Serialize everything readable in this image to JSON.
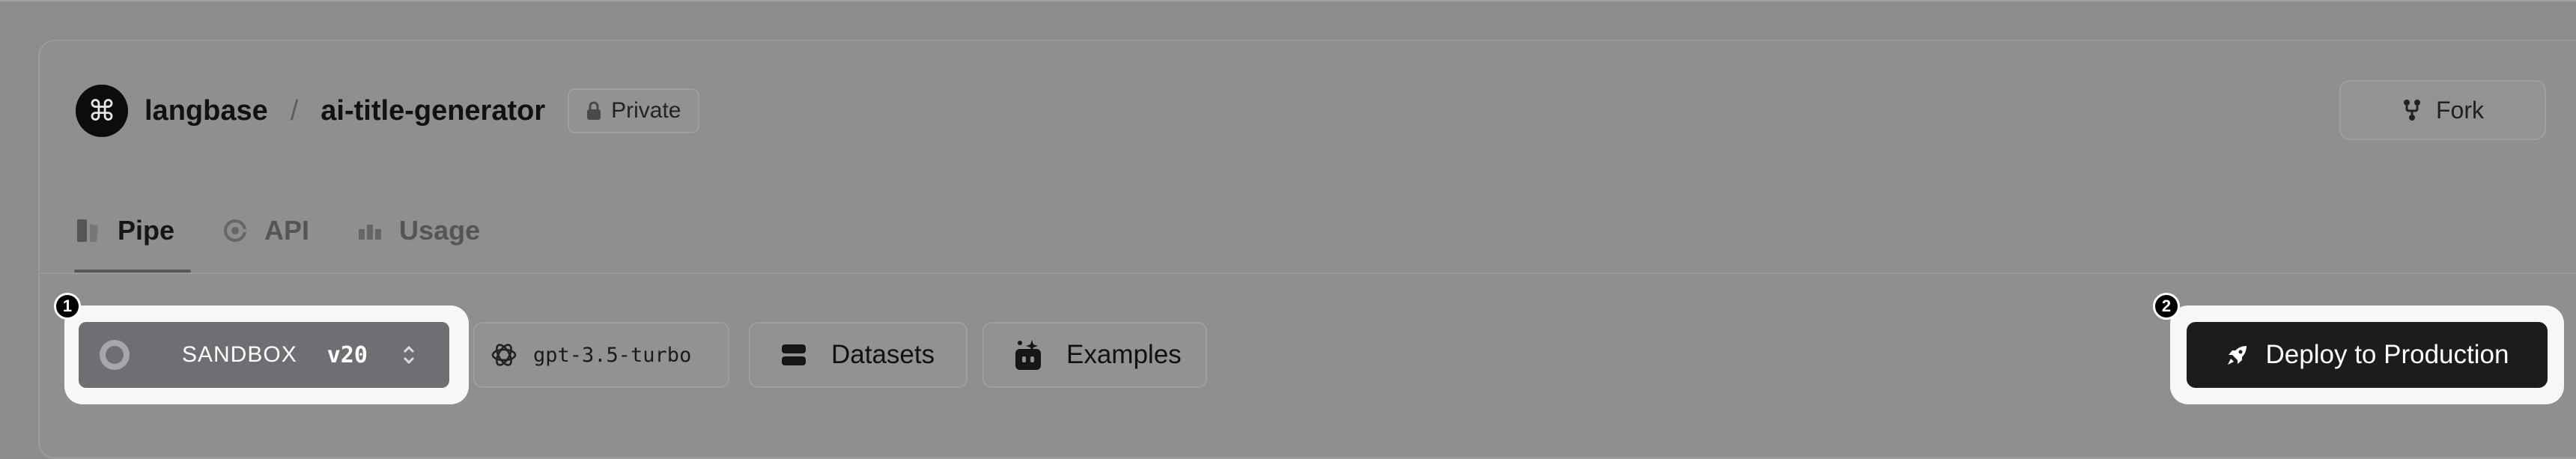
{
  "header": {
    "org_logo_glyph": "⌘",
    "org_name": "langbase",
    "separator": "/",
    "repo_name": "ai-title-generator",
    "visibility": "Private",
    "fork_label": "Fork"
  },
  "tabs": [
    {
      "label": "Pipe",
      "icon": "pipe-icon",
      "active": true
    },
    {
      "label": "API",
      "icon": "api-icon",
      "active": false
    },
    {
      "label": "Usage",
      "icon": "usage-bars-icon",
      "active": false
    }
  ],
  "toolbar": {
    "environment": "SANDBOX",
    "version": "v20",
    "model": "gpt-3.5-turbo",
    "datasets_label": "Datasets",
    "examples_label": "Examples",
    "deploy_label": "Deploy to Production"
  },
  "callouts": {
    "first": "1",
    "second": "2"
  },
  "colors": {
    "overlay_background": "#8c8c8c",
    "deploy_button": "#1c1c1f",
    "version_select": "#6e6e73",
    "highlight": "#f7f7f7"
  }
}
